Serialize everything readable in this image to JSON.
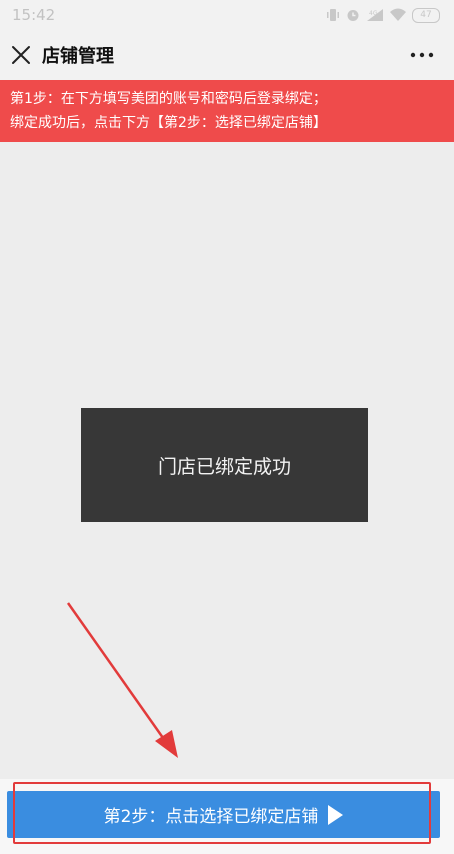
{
  "status_bar": {
    "time": "15:42",
    "battery": "47"
  },
  "header": {
    "title": "店铺管理",
    "close_icon": "close-icon",
    "more_icon": "more-icon"
  },
  "notice": {
    "line1": "第1步：在下方填写美团的账号和密码后登录绑定；",
    "line2": "绑定成功后，点击下方【第2步：选择已绑定店铺】"
  },
  "toast": {
    "message": "门店已绑定成功"
  },
  "bottom": {
    "button_label": "第2步：点击选择已绑定店铺",
    "button_icon": "play-icon"
  },
  "colors": {
    "notice_bg": "#ef4b4b",
    "button_bg": "#3a8de0",
    "toast_bg": "#373737",
    "annotation": "#e23b3b"
  }
}
